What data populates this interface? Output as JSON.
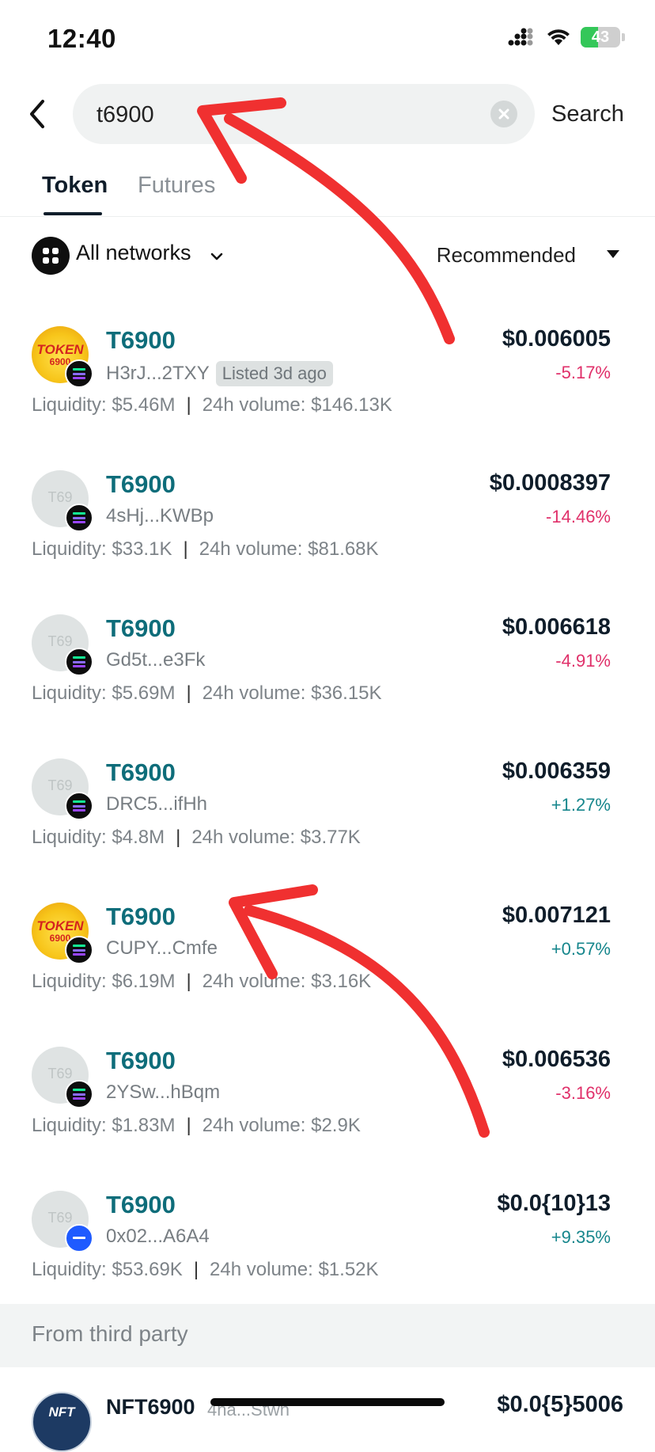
{
  "status_bar": {
    "time": "12:40",
    "battery": "43",
    "battery_level": 0.43
  },
  "search": {
    "query": "t6900",
    "submit_label": "Search"
  },
  "tabs": [
    {
      "label": "Token",
      "active": true
    },
    {
      "label": "Futures",
      "active": false
    }
  ],
  "filters": {
    "network_label": "All networks",
    "sort_label": "Recommended"
  },
  "tokens": [
    {
      "name": "T6900",
      "address": "H3rJ...2TXY",
      "badge": "Listed 3d ago",
      "price": "$0.006005",
      "change": "-5.17%",
      "liquidity": "Liquidity: $5.46M",
      "volume": "24h volume: $146.13K",
      "avatar": "logo",
      "placeholder": "",
      "chain": "solana"
    },
    {
      "name": "T6900",
      "address": "4sHj...KWBp",
      "badge": "",
      "price": "$0.0008397",
      "change": "-14.46%",
      "liquidity": "Liquidity: $33.1K",
      "volume": "24h volume: $81.68K",
      "avatar": "placeholder",
      "placeholder": "T69",
      "chain": "solana"
    },
    {
      "name": "T6900",
      "address": "Gd5t...e3Fk",
      "badge": "",
      "price": "$0.006618",
      "change": "-4.91%",
      "liquidity": "Liquidity: $5.69M",
      "volume": "24h volume: $36.15K",
      "avatar": "placeholder",
      "placeholder": "T69",
      "chain": "solana"
    },
    {
      "name": "T6900",
      "address": "DRC5...ifHh",
      "badge": "",
      "price": "$0.006359",
      "change": "+1.27%",
      "liquidity": "Liquidity: $4.8M",
      "volume": "24h volume: $3.77K",
      "avatar": "placeholder",
      "placeholder": "T69",
      "chain": "solana"
    },
    {
      "name": "T6900",
      "address": "CUPY...Cmfe",
      "badge": "",
      "price": "$0.007121",
      "change": "+0.57%",
      "liquidity": "Liquidity: $6.19M",
      "volume": "24h volume: $3.16K",
      "avatar": "logo",
      "placeholder": "",
      "chain": "solana"
    },
    {
      "name": "T6900",
      "address": "2YSw...hBqm",
      "badge": "",
      "price": "$0.006536",
      "change": "-3.16%",
      "liquidity": "Liquidity: $1.83M",
      "volume": "24h volume: $2.9K",
      "avatar": "placeholder",
      "placeholder": "T69",
      "chain": "solana"
    },
    {
      "name": "T6900",
      "address": "0x02...A6A4",
      "badge": "",
      "price": "$0.0{10}13",
      "change": "+9.35%",
      "liquidity": "Liquidity: $53.69K",
      "volume": "24h volume: $1.52K",
      "avatar": "placeholder",
      "placeholder": "T69",
      "chain": "ethereum"
    }
  ],
  "logo_text": {
    "line1": "TOKEN",
    "line2": "6900"
  },
  "third_party": {
    "header": "From third party",
    "item": {
      "name": "NFT6900",
      "address": "4na...Stwn",
      "price": "$0.0{5}5006",
      "avatar_text": "NFT"
    }
  },
  "colors": {
    "accent": "#0e6d7a",
    "negative": "#e0306a",
    "positive": "#16868c",
    "annotation_arrow": "#f03030"
  }
}
